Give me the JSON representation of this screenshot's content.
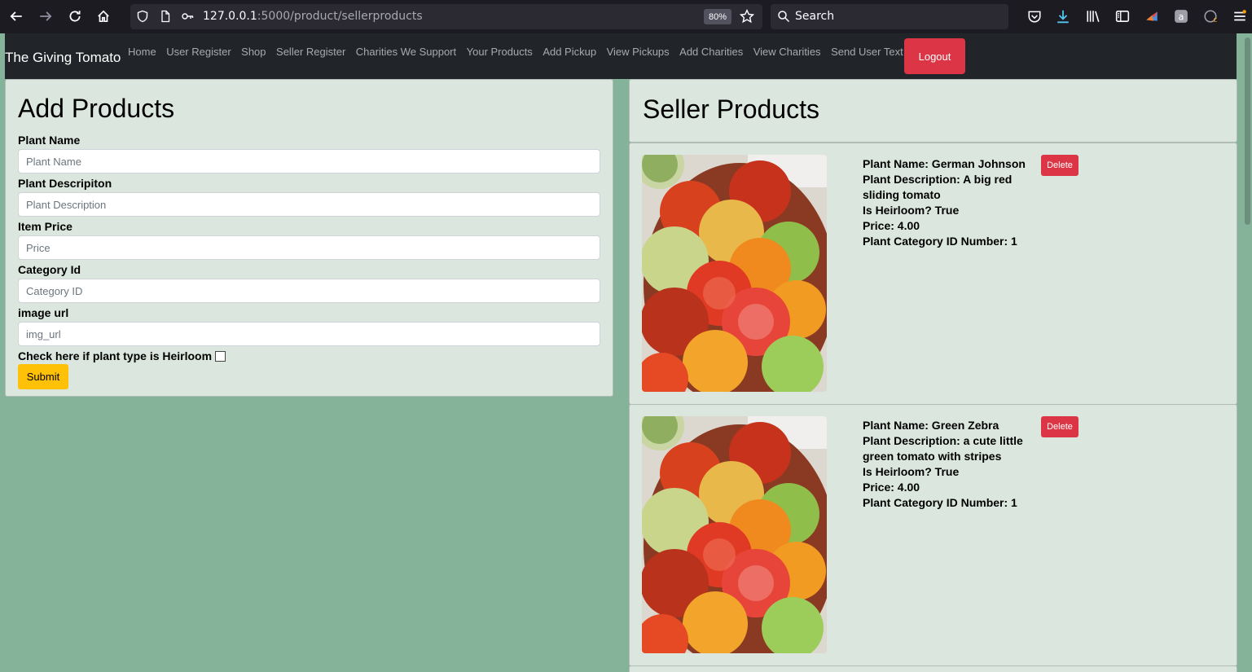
{
  "browser": {
    "url_host": "127.0.0.1",
    "url_path": ":5000/product/sellerproducts",
    "zoom": "80%",
    "search_placeholder": "Search"
  },
  "navbar": {
    "brand": "The Giving Tomato",
    "links": [
      "Home",
      "User Register",
      "Shop",
      "Seller Register",
      "Charities We Support",
      "Your Products",
      "Add Pickup",
      "View Pickups",
      "Add Charities",
      "View Charities",
      "Send User Text"
    ],
    "logout": "Logout"
  },
  "add_form": {
    "title": "Add Products",
    "fields": [
      {
        "label": "Plant Name",
        "placeholder": "Plant Name"
      },
      {
        "label": "Plant Descripiton",
        "placeholder": "Plant Description"
      },
      {
        "label": "Item Price",
        "placeholder": "Price"
      },
      {
        "label": "Category Id",
        "placeholder": "Category ID"
      },
      {
        "label": "image url",
        "placeholder": "img_url"
      }
    ],
    "heirloom_label": "Check here if plant type is Heirloom",
    "submit": "Submit"
  },
  "seller_products": {
    "title": "Seller Products",
    "delete_label": "Delete",
    "items": [
      {
        "name_line": "Plant Name: German Johnson",
        "desc_line": "Plant Description: A big red sliding tomato",
        "heirloom_line": "Is Heirloom? True",
        "price_line": "Price: 4.00",
        "category_line": "Plant Category ID Number: 1"
      },
      {
        "name_line": "Plant Name: Green Zebra",
        "desc_line": "Plant Description: a cute little green tomato with stripes",
        "heirloom_line": "Is Heirloom? True",
        "price_line": "Price: 4.00",
        "category_line": "Plant Category ID Number: 1"
      }
    ]
  }
}
